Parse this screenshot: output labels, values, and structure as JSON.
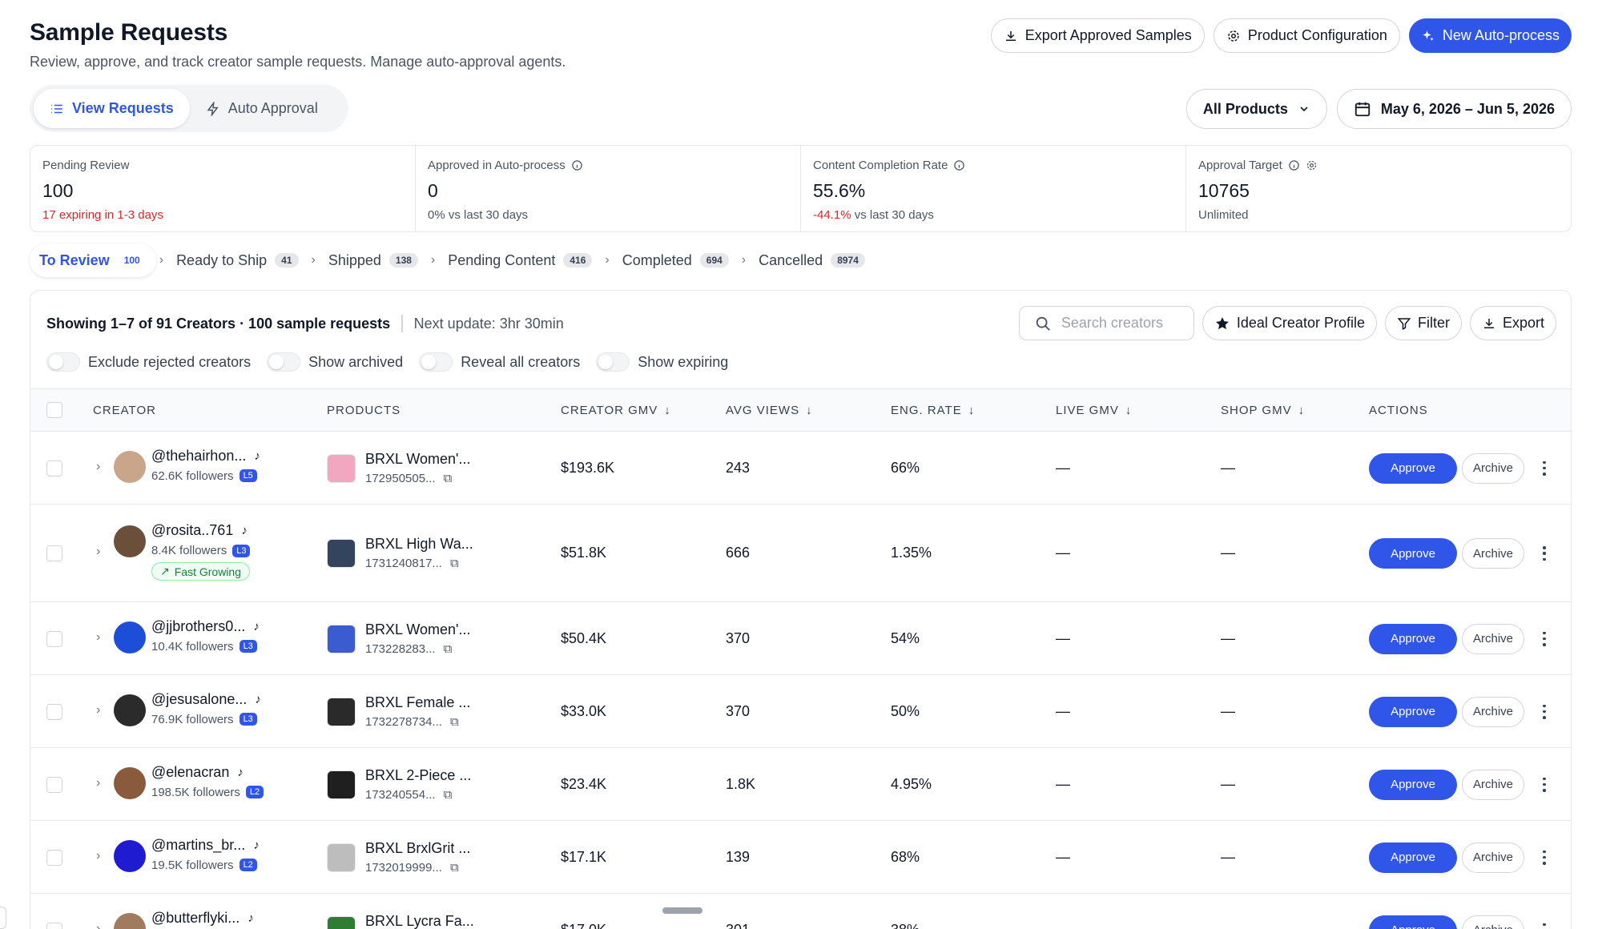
{
  "header": {
    "title": "Sample Requests",
    "subtitle": "Review, approve, and track creator sample requests. Manage auto-approval agents.",
    "export_approved_label": "Export Approved Samples",
    "product_config_label": "Product Configuration",
    "new_auto_process_label": "New Auto-process"
  },
  "view_tabs": [
    {
      "label": "View Requests",
      "active": true
    },
    {
      "label": "Auto Approval",
      "active": false
    }
  ],
  "filters": {
    "products_label": "All Products",
    "date_range": "May 6, 2026 – Jun 5, 2026"
  },
  "kpis": [
    {
      "label": "Pending Review",
      "value": "100",
      "sub": "17 expiring in 1-3 days"
    },
    {
      "label": "Approved in Auto-process",
      "value": "0",
      "sub": "0% vs last 30 days"
    },
    {
      "label": "Content Completion Rate",
      "value": "55.6%",
      "sub_neg": "-44.1%",
      "sub": "vs last 30 days"
    },
    {
      "label": "Approval Target",
      "value": "10765",
      "sub": "Unlimited"
    }
  ],
  "status_tabs": [
    {
      "label": "To Review",
      "count": "100"
    },
    {
      "label": "Ready to Ship",
      "count": "41"
    },
    {
      "label": "Shipped",
      "count": "138"
    },
    {
      "label": "Pending Content",
      "count": "416"
    },
    {
      "label": "Completed",
      "count": "694"
    },
    {
      "label": "Cancelled",
      "count": "8974"
    }
  ],
  "table_toolbar": {
    "showing": "Showing 1–7 of 91 Creators · 100 sample requests",
    "next_update": "Next update: 3hr 30min",
    "search_placeholder": "Search creators",
    "icp_label": "Ideal Creator Profile",
    "filter_label": "Filter",
    "export_label": "Export",
    "toggles": [
      "Exclude rejected creators",
      "Show archived",
      "Reveal all creators",
      "Show expiring"
    ]
  },
  "columns": {
    "creator": "CREATOR",
    "products": "PRODUCTS",
    "creator_gmv": "CREATOR GMV",
    "avg_views": "AVG VIEWS",
    "eng_rate": "ENG. RATE",
    "live_gmv": "LIVE GMV",
    "shop_gmv": "SHOP GMV",
    "actions": "ACTIONS"
  },
  "row_actions": {
    "approve": "Approve",
    "archive": "Archive"
  },
  "rows": [
    {
      "handle": "@thehairhon...",
      "followers": "62.6K followers",
      "level": "L5",
      "tag": "",
      "product": "BRXL Women'...",
      "product_id": "172950505...",
      "gmv": "$193.6K",
      "views": "243",
      "eng": "66%",
      "live": "—",
      "shop": "—"
    },
    {
      "handle": "@rosita..761",
      "followers": "8.4K followers",
      "level": "L3",
      "tag": "Fast Growing",
      "product": "BRXL High Wa...",
      "product_id": "1731240817...",
      "gmv": "$51.8K",
      "views": "666",
      "eng": "1.35%",
      "live": "—",
      "shop": "—"
    },
    {
      "handle": "@jjbrothers0...",
      "followers": "10.4K followers",
      "level": "L3",
      "tag": "",
      "product": "BRXL Women'...",
      "product_id": "173228283...",
      "gmv": "$50.4K",
      "views": "370",
      "eng": "54%",
      "live": "—",
      "shop": "—"
    },
    {
      "handle": "@jesusalone...",
      "followers": "76.9K followers",
      "level": "L3",
      "tag": "",
      "product": "BRXL Female ...",
      "product_id": "1732278734...",
      "gmv": "$33.0K",
      "views": "370",
      "eng": "50%",
      "live": "—",
      "shop": "—"
    },
    {
      "handle": "@elenacran",
      "followers": "198.5K followers",
      "level": "L2",
      "tag": "",
      "product": "BRXL 2-Piece ...",
      "product_id": "173240554...",
      "gmv": "$23.4K",
      "views": "1.8K",
      "eng": "4.95%",
      "live": "—",
      "shop": "—"
    },
    {
      "handle": "@martins_br...",
      "followers": "19.5K followers",
      "level": "L2",
      "tag": "",
      "product": "BRXL BrxlGrit ...",
      "product_id": "1732019999...",
      "gmv": "$17.1K",
      "views": "139",
      "eng": "68%",
      "live": "—",
      "shop": "—"
    },
    {
      "handle": "@butterflyki...",
      "followers": "",
      "level": "",
      "tag": "",
      "product": "BRXL Lycra Fa...",
      "product_id": "",
      "gmv": "$17.0K",
      "views": "301",
      "eng": "38%",
      "live": "",
      "shop": ""
    }
  ],
  "colors": {
    "accent": "#2f56e8",
    "negative": "#dc2626",
    "success": "#15803d"
  }
}
